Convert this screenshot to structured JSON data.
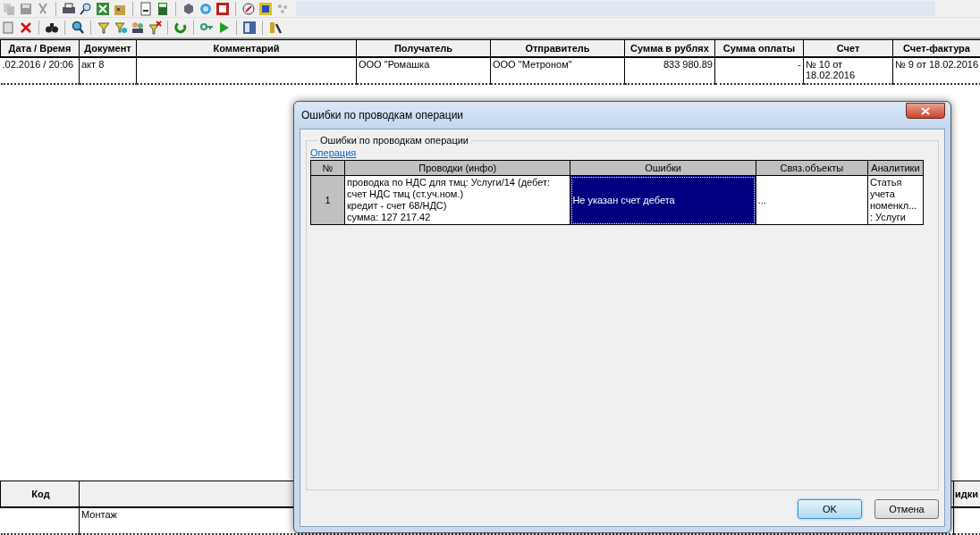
{
  "main_table": {
    "columns": [
      "Дата / Время",
      "Документ",
      "Комментарий",
      "Получатель",
      "Отправитель",
      "Сумма в рублях",
      "Сумма оплаты",
      "Счет",
      "Счет-фактура"
    ],
    "rows": [
      {
        "cells": [
          ".02.2016 / 20:06",
          "акт 8",
          "",
          "ООО \"Ромашка",
          "ООО \"Метроном\"",
          "833 980.89",
          "-",
          "№ 10 от\n18.02.2016",
          "№ 9 от 18.02.2016"
        ]
      }
    ]
  },
  "lower_table": {
    "columns": [
      "Код",
      "",
      "идки"
    ],
    "rows": [
      {
        "cells": [
          "",
          "Монтаж",
          ""
        ]
      }
    ]
  },
  "dialog": {
    "title": "Ошибки по проводкам операции",
    "group_title": "Ошибки по проводкам операции",
    "link": "Операция",
    "grid": {
      "columns": [
        "№",
        "Проводки (инфо)",
        "Ошибки",
        "Связ.объекты",
        "Аналитики"
      ],
      "rows": [
        {
          "number": "1",
          "info": "проводка по НДС для тмц: Услуги/14 (дебет:\nсчет НДС тмц (ст.уч.ном.)\nкредит - счет 68/НДС)\nсумма: 127 217.42",
          "error": "Не указан счет дебета",
          "error_selected": true,
          "linked": "...",
          "analytics": "Статья\nучета\nноменкл...\n: Услуги"
        }
      ]
    },
    "buttons": [
      {
        "label": "OK",
        "default": true
      },
      {
        "label": "Отмена",
        "default": false
      }
    ]
  }
}
